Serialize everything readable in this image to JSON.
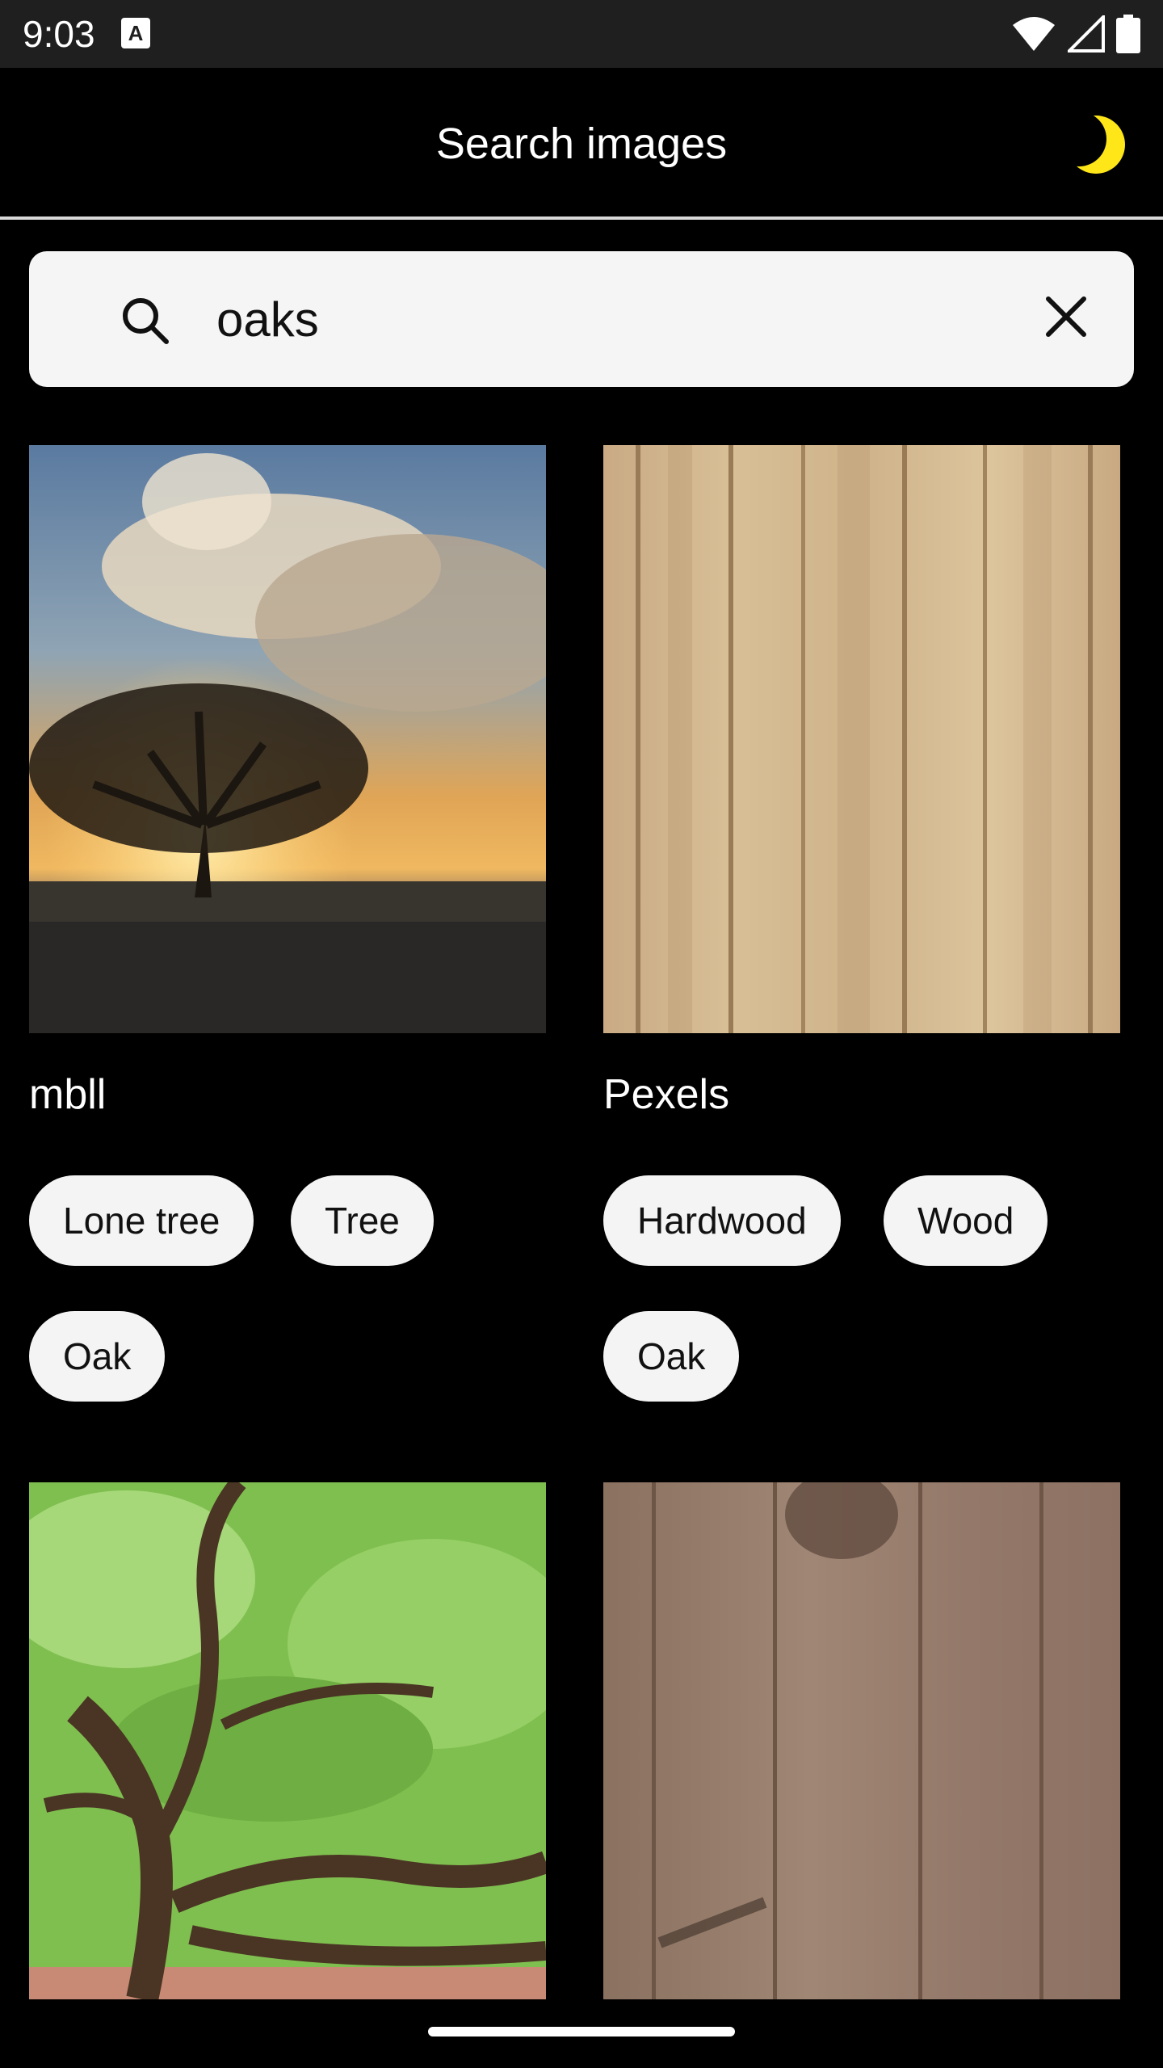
{
  "status_bar": {
    "time": "9:03",
    "notification_icon": "a-keyboard-icon",
    "icons": [
      "wifi-icon",
      "cell-signal-icon",
      "battery-icon"
    ]
  },
  "app_bar": {
    "title": "Search images",
    "theme_toggle_icon": "moon-icon",
    "accent_color": "#FFE619"
  },
  "search": {
    "value": "oaks",
    "search_icon": "search-icon",
    "clear_icon": "close-icon"
  },
  "results": [
    {
      "author": "mbll",
      "image": "lone oak tree at sunset",
      "tags": [
        "Lone tree",
        "Tree",
        "Oak"
      ]
    },
    {
      "author": "Pexels",
      "image": "light vertical wood planks",
      "tags": [
        "Hardwood",
        "Wood",
        "Oak"
      ]
    },
    {
      "image": "sprawling green oak tree"
    },
    {
      "image": "dark wood planks"
    }
  ]
}
